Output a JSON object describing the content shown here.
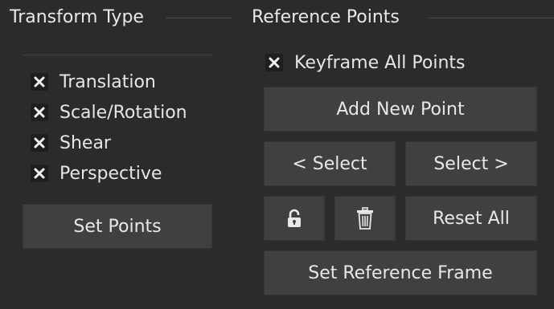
{
  "transform_type": {
    "title": "Transform Type",
    "options": [
      {
        "label": "Translation",
        "checked": true
      },
      {
        "label": "Scale/Rotation",
        "checked": true
      },
      {
        "label": "Shear",
        "checked": true
      },
      {
        "label": "Perspective",
        "checked": true
      }
    ],
    "set_points_label": "Set Points"
  },
  "reference_points": {
    "title": "Reference Points",
    "keyframe_all": {
      "label": "Keyframe All Points",
      "checked": true
    },
    "add_new_point_label": "Add New Point",
    "select_prev_label": "< Select",
    "select_next_label": "Select >",
    "lock_icon": "lock-icon",
    "trash_icon": "trash-icon",
    "reset_all_label": "Reset All",
    "set_reference_frame_label": "Set Reference Frame"
  },
  "colors": {
    "background": "#2b2b2b",
    "button": "#404040",
    "checkbox_bg": "#1e1e1e",
    "text": "#e6e6e6"
  }
}
